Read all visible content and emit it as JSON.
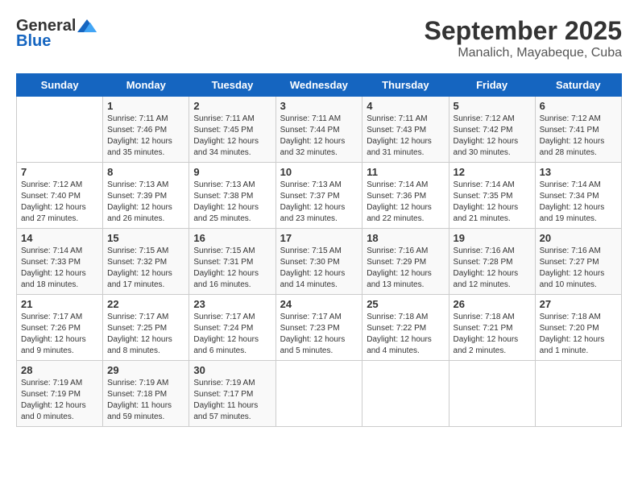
{
  "logo": {
    "general": "General",
    "blue": "Blue"
  },
  "header": {
    "month": "September 2025",
    "location": "Manalich, Mayabeque, Cuba"
  },
  "days_of_week": [
    "Sunday",
    "Monday",
    "Tuesday",
    "Wednesday",
    "Thursday",
    "Friday",
    "Saturday"
  ],
  "weeks": [
    [
      {
        "day": "",
        "info": ""
      },
      {
        "day": "1",
        "info": "Sunrise: 7:11 AM\nSunset: 7:46 PM\nDaylight: 12 hours\nand 35 minutes."
      },
      {
        "day": "2",
        "info": "Sunrise: 7:11 AM\nSunset: 7:45 PM\nDaylight: 12 hours\nand 34 minutes."
      },
      {
        "day": "3",
        "info": "Sunrise: 7:11 AM\nSunset: 7:44 PM\nDaylight: 12 hours\nand 32 minutes."
      },
      {
        "day": "4",
        "info": "Sunrise: 7:11 AM\nSunset: 7:43 PM\nDaylight: 12 hours\nand 31 minutes."
      },
      {
        "day": "5",
        "info": "Sunrise: 7:12 AM\nSunset: 7:42 PM\nDaylight: 12 hours\nand 30 minutes."
      },
      {
        "day": "6",
        "info": "Sunrise: 7:12 AM\nSunset: 7:41 PM\nDaylight: 12 hours\nand 28 minutes."
      }
    ],
    [
      {
        "day": "7",
        "info": "Sunrise: 7:12 AM\nSunset: 7:40 PM\nDaylight: 12 hours\nand 27 minutes."
      },
      {
        "day": "8",
        "info": "Sunrise: 7:13 AM\nSunset: 7:39 PM\nDaylight: 12 hours\nand 26 minutes."
      },
      {
        "day": "9",
        "info": "Sunrise: 7:13 AM\nSunset: 7:38 PM\nDaylight: 12 hours\nand 25 minutes."
      },
      {
        "day": "10",
        "info": "Sunrise: 7:13 AM\nSunset: 7:37 PM\nDaylight: 12 hours\nand 23 minutes."
      },
      {
        "day": "11",
        "info": "Sunrise: 7:14 AM\nSunset: 7:36 PM\nDaylight: 12 hours\nand 22 minutes."
      },
      {
        "day": "12",
        "info": "Sunrise: 7:14 AM\nSunset: 7:35 PM\nDaylight: 12 hours\nand 21 minutes."
      },
      {
        "day": "13",
        "info": "Sunrise: 7:14 AM\nSunset: 7:34 PM\nDaylight: 12 hours\nand 19 minutes."
      }
    ],
    [
      {
        "day": "14",
        "info": "Sunrise: 7:14 AM\nSunset: 7:33 PM\nDaylight: 12 hours\nand 18 minutes."
      },
      {
        "day": "15",
        "info": "Sunrise: 7:15 AM\nSunset: 7:32 PM\nDaylight: 12 hours\nand 17 minutes."
      },
      {
        "day": "16",
        "info": "Sunrise: 7:15 AM\nSunset: 7:31 PM\nDaylight: 12 hours\nand 16 minutes."
      },
      {
        "day": "17",
        "info": "Sunrise: 7:15 AM\nSunset: 7:30 PM\nDaylight: 12 hours\nand 14 minutes."
      },
      {
        "day": "18",
        "info": "Sunrise: 7:16 AM\nSunset: 7:29 PM\nDaylight: 12 hours\nand 13 minutes."
      },
      {
        "day": "19",
        "info": "Sunrise: 7:16 AM\nSunset: 7:28 PM\nDaylight: 12 hours\nand 12 minutes."
      },
      {
        "day": "20",
        "info": "Sunrise: 7:16 AM\nSunset: 7:27 PM\nDaylight: 12 hours\nand 10 minutes."
      }
    ],
    [
      {
        "day": "21",
        "info": "Sunrise: 7:17 AM\nSunset: 7:26 PM\nDaylight: 12 hours\nand 9 minutes."
      },
      {
        "day": "22",
        "info": "Sunrise: 7:17 AM\nSunset: 7:25 PM\nDaylight: 12 hours\nand 8 minutes."
      },
      {
        "day": "23",
        "info": "Sunrise: 7:17 AM\nSunset: 7:24 PM\nDaylight: 12 hours\nand 6 minutes."
      },
      {
        "day": "24",
        "info": "Sunrise: 7:17 AM\nSunset: 7:23 PM\nDaylight: 12 hours\nand 5 minutes."
      },
      {
        "day": "25",
        "info": "Sunrise: 7:18 AM\nSunset: 7:22 PM\nDaylight: 12 hours\nand 4 minutes."
      },
      {
        "day": "26",
        "info": "Sunrise: 7:18 AM\nSunset: 7:21 PM\nDaylight: 12 hours\nand 2 minutes."
      },
      {
        "day": "27",
        "info": "Sunrise: 7:18 AM\nSunset: 7:20 PM\nDaylight: 12 hours\nand 1 minute."
      }
    ],
    [
      {
        "day": "28",
        "info": "Sunrise: 7:19 AM\nSunset: 7:19 PM\nDaylight: 12 hours\nand 0 minutes."
      },
      {
        "day": "29",
        "info": "Sunrise: 7:19 AM\nSunset: 7:18 PM\nDaylight: 11 hours\nand 59 minutes."
      },
      {
        "day": "30",
        "info": "Sunrise: 7:19 AM\nSunset: 7:17 PM\nDaylight: 11 hours\nand 57 minutes."
      },
      {
        "day": "",
        "info": ""
      },
      {
        "day": "",
        "info": ""
      },
      {
        "day": "",
        "info": ""
      },
      {
        "day": "",
        "info": ""
      }
    ]
  ]
}
